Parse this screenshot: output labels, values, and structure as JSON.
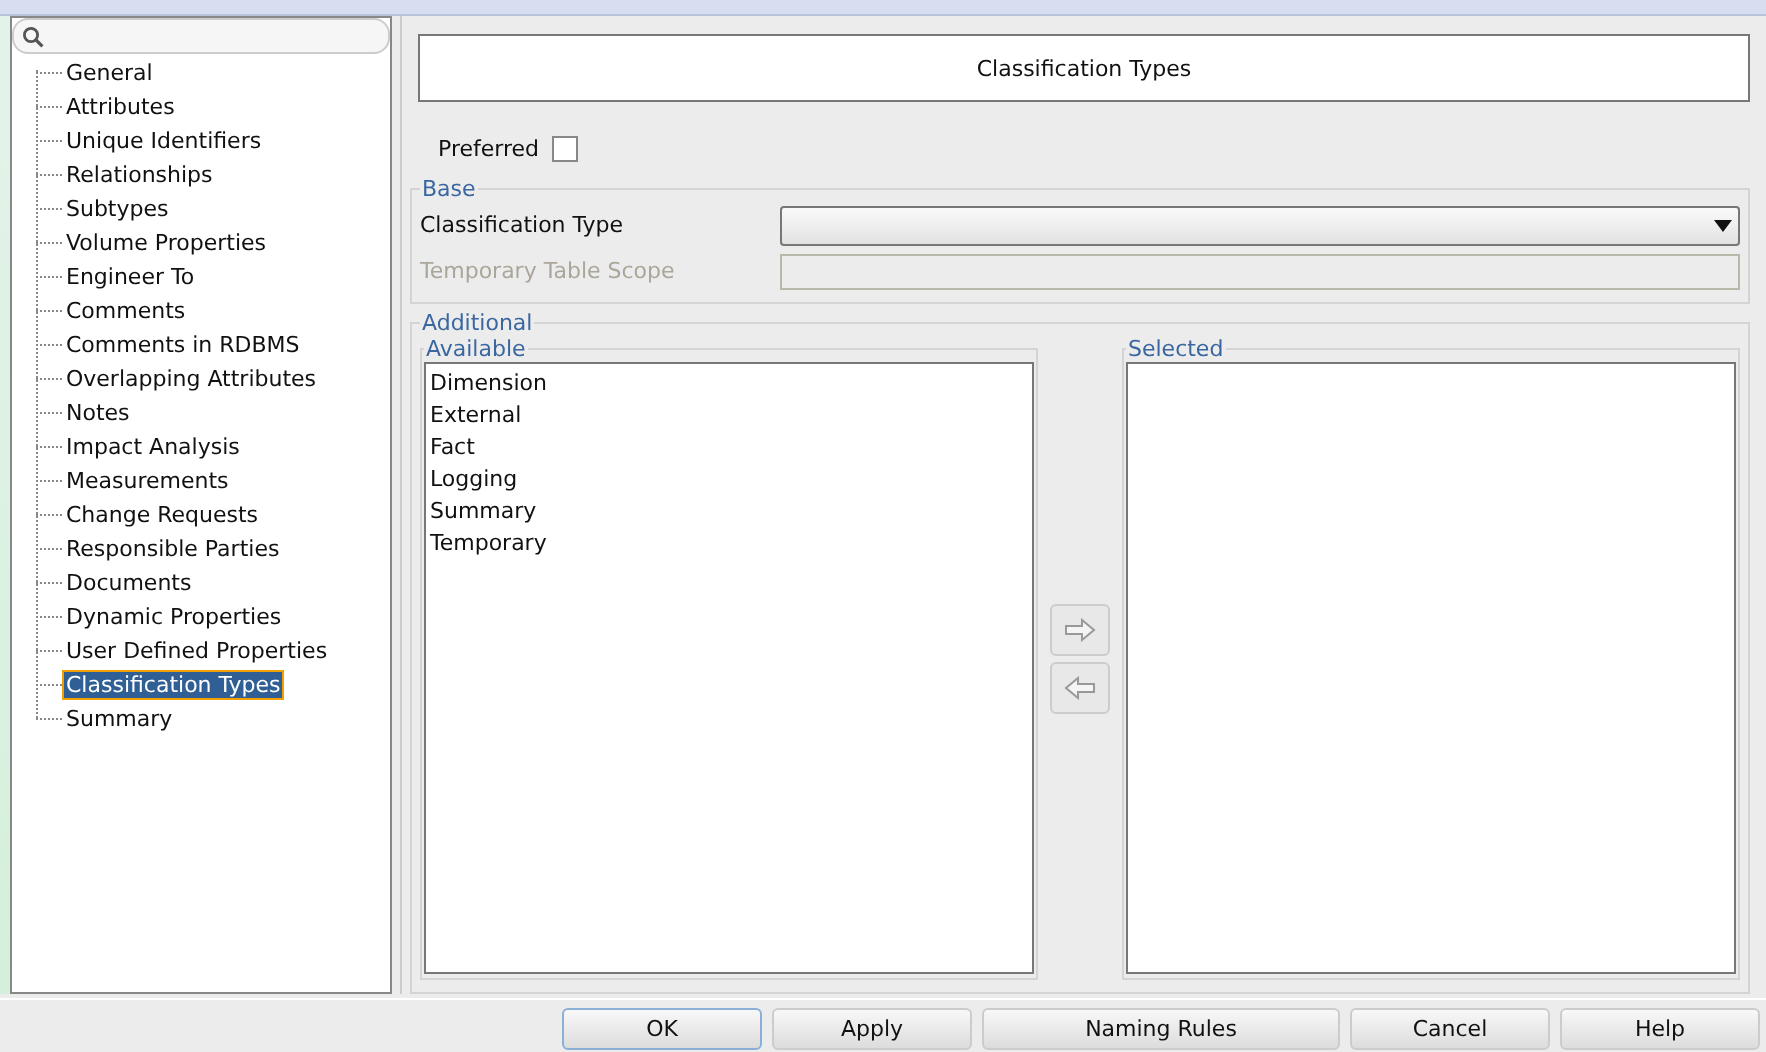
{
  "tree": {
    "items": [
      {
        "label": "General",
        "selected": false
      },
      {
        "label": "Attributes",
        "selected": false
      },
      {
        "label": "Unique Identifiers",
        "selected": false
      },
      {
        "label": "Relationships",
        "selected": false
      },
      {
        "label": "Subtypes",
        "selected": false
      },
      {
        "label": "Volume Properties",
        "selected": false
      },
      {
        "label": "Engineer To",
        "selected": false
      },
      {
        "label": "Comments",
        "selected": false
      },
      {
        "label": "Comments in RDBMS",
        "selected": false
      },
      {
        "label": "Overlapping Attributes",
        "selected": false
      },
      {
        "label": "Notes",
        "selected": false
      },
      {
        "label": "Impact Analysis",
        "selected": false
      },
      {
        "label": "Measurements",
        "selected": false
      },
      {
        "label": "Change Requests",
        "selected": false
      },
      {
        "label": "Responsible Parties",
        "selected": false
      },
      {
        "label": "Documents",
        "selected": false
      },
      {
        "label": "Dynamic Properties",
        "selected": false
      },
      {
        "label": "User Defined Properties",
        "selected": false
      },
      {
        "label": "Classification Types",
        "selected": true
      },
      {
        "label": "Summary",
        "selected": false
      }
    ]
  },
  "header": "Classification Types",
  "preferred": {
    "label": "Preferred",
    "checked": false
  },
  "base": {
    "title": "Base",
    "classification_type": {
      "label": "Classification Type",
      "disabled": false
    },
    "temporary_table_scope": {
      "label": "Temporary Table Scope",
      "disabled": true
    }
  },
  "additional": {
    "title": "Additional",
    "available": {
      "title": "Available",
      "items": [
        "Dimension",
        "External",
        "Fact",
        "Logging",
        "Summary",
        "Temporary"
      ]
    },
    "selected": {
      "title": "Selected"
    }
  },
  "buttons": [
    {
      "label": "OK",
      "focused": true
    },
    {
      "label": "Apply",
      "focused": false
    },
    {
      "label": "Naming Rules",
      "focused": false
    },
    {
      "label": "Cancel",
      "focused": false
    },
    {
      "label": "Help",
      "focused": false
    }
  ]
}
